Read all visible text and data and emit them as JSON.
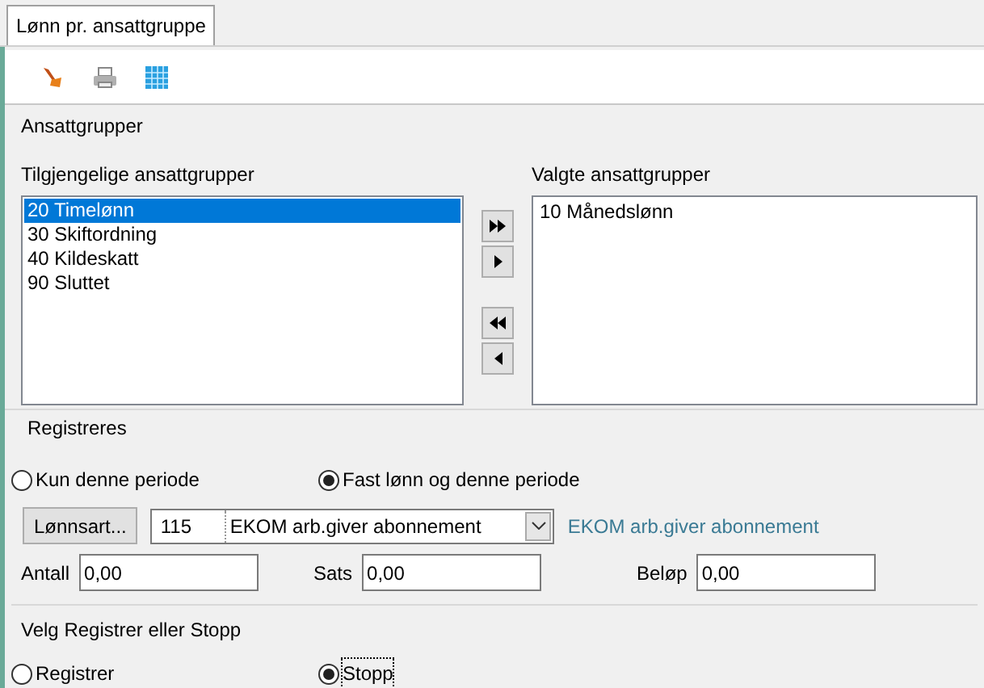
{
  "tabs": [
    {
      "label": "Lønn pr. ansattgruppe",
      "selected": true
    }
  ],
  "toolbar": [
    {
      "kind": "brush"
    },
    {
      "kind": "printer"
    },
    {
      "kind": "grid"
    }
  ],
  "groups": {
    "title": "Ansattgrupper",
    "available_label": "Tilgjengelige ansattgrupper",
    "selected_label": "Valgte ansattgrupper",
    "available": [
      {
        "label": "20 Timelønn",
        "selected": true
      },
      {
        "label": "30 Skiftordning",
        "selected": false
      },
      {
        "label": "40 Kildeskatt",
        "selected": false
      },
      {
        "label": "90 Sluttet",
        "selected": false
      }
    ],
    "chosen": [
      {
        "label": "10 Månedslønn",
        "selected": false
      }
    ],
    "move_buttons": [
      {
        "kind": "all-right"
      },
      {
        "kind": "right"
      },
      {
        "kind": "all-left"
      },
      {
        "kind": "left"
      }
    ]
  },
  "register": {
    "title": "Registreres",
    "options": [
      {
        "label": "Kun denne periode",
        "selected": false
      },
      {
        "label": "Fast lønn og denne periode",
        "selected": true
      }
    ],
    "wage_button": "Lønnsart...",
    "code": "115",
    "wage_type": "EKOM arb.giver abonnement",
    "wage_type_note": "EKOM arb.giver abonnement",
    "fields": [
      {
        "label": "Antall",
        "value": "0,00"
      },
      {
        "label": "Sats",
        "value": "0,00"
      },
      {
        "label": "Beløp",
        "value": "0,00"
      }
    ]
  },
  "action": {
    "title": "Velg Registrer eller Stopp",
    "options": [
      {
        "label": "Registrer",
        "selected": false,
        "focused": false
      },
      {
        "label": "Stopp",
        "selected": true,
        "focused": true
      }
    ]
  }
}
